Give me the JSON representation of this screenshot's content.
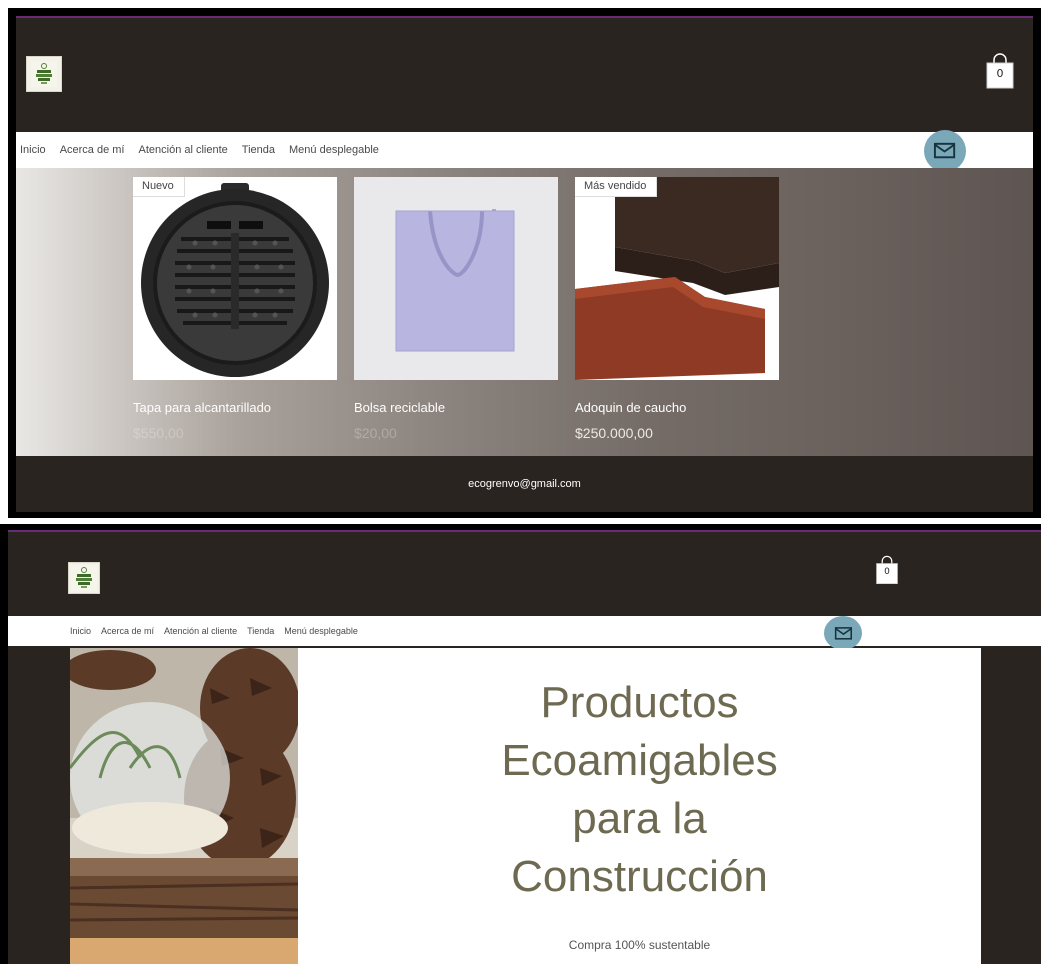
{
  "top_view": {
    "cart": {
      "count": "0"
    },
    "nav": {
      "items": [
        "Inicio",
        "Acerca de mí",
        "Atención al cliente",
        "Tienda",
        "Menú desplegable"
      ]
    },
    "products": [
      {
        "badge": "Nuevo",
        "name": "Tapa para alcantarillado",
        "price": "$550,00"
      },
      {
        "badge": "",
        "name": "Bolsa reciclable",
        "price": "$20,00"
      },
      {
        "badge": "Más vendido",
        "name": "Adoquin de caucho",
        "price": "$250.000,00"
      }
    ],
    "footer": {
      "email": "ecogrenvo@gmail.com"
    }
  },
  "bottom_view": {
    "cart": {
      "count": "0"
    },
    "nav": {
      "items": [
        "Inicio",
        "Acerca de mí",
        "Atención al cliente",
        "Tienda",
        "Menú desplegable"
      ]
    },
    "hero": {
      "title_lines": [
        "Productos",
        "Ecoamigables",
        "para la",
        "Construcción"
      ],
      "subtitle": "Compra 100% sustentable"
    }
  },
  "colors": {
    "header_bg": "#2a2420",
    "accent_line": "#6a2a78",
    "mail_button": "#7aa8b8",
    "hero_title": "#6e6a52"
  },
  "icons": [
    "logo-icon",
    "shopping-bag-icon",
    "mail-icon"
  ]
}
